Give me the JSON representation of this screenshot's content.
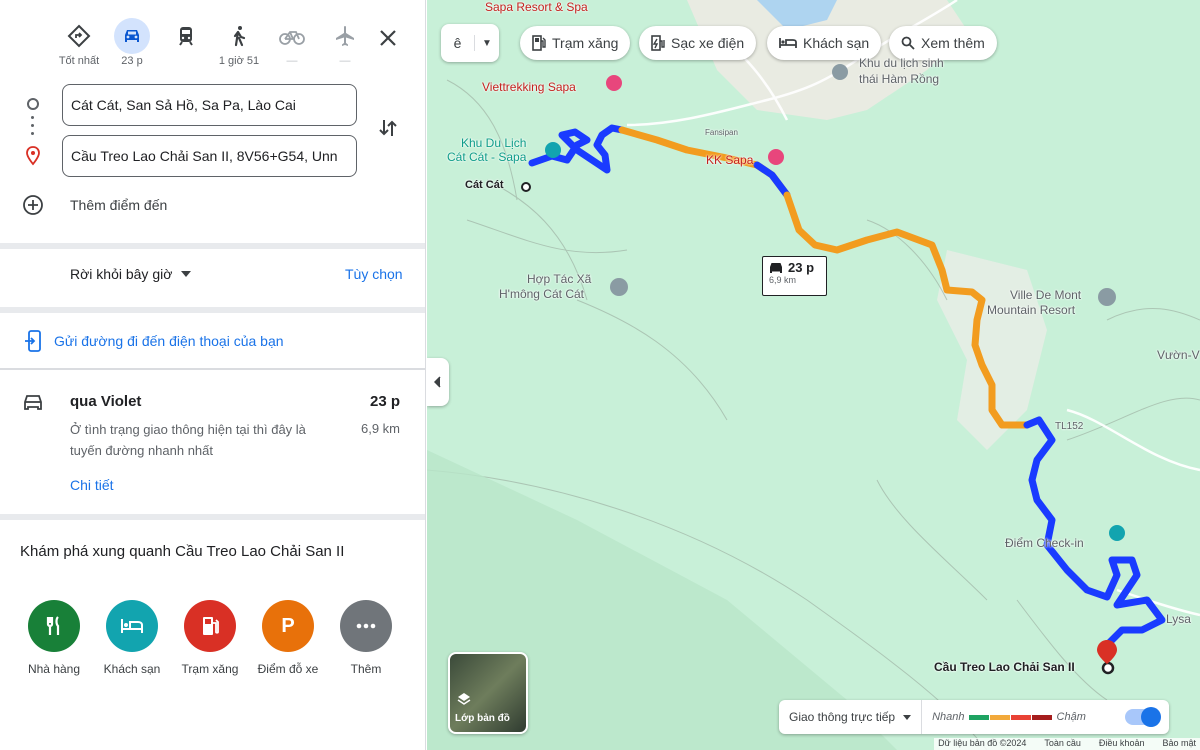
{
  "travel_modes": [
    {
      "name": "best",
      "label": "Tốt nhất"
    },
    {
      "name": "driving",
      "label": "23 p"
    },
    {
      "name": "transit",
      "label": ""
    },
    {
      "name": "walking",
      "label": "1 giờ 51"
    },
    {
      "name": "cycling",
      "label": "—"
    },
    {
      "name": "flight",
      "label": "—"
    }
  ],
  "directions": {
    "origin": "Cát Cát, San Sả Hồ, Sa Pa, Lào Cai",
    "destination": "Cầu Treo Lao Chải San II, 8V56+G54, Unn",
    "add_destination": "Thêm điểm đến"
  },
  "departure": {
    "label": "Rời khỏi bây giờ",
    "options": "Tùy chọn"
  },
  "send_to_phone": "Gửi đường đi đến điện thoại của bạn",
  "route": {
    "via": "qua Violet",
    "time": "23 p",
    "distance": "6,9 km",
    "description": "Ở tình trạng giao thông hiện tại thì đây là tuyến đường nhanh nhất",
    "details_link": "Chi tiết"
  },
  "explore": {
    "title": "Khám phá xung quanh Cầu Treo Lao Chải San II",
    "categories": [
      {
        "label": "Nhà hàng",
        "icon": "restaurant-icon",
        "color": "#188038"
      },
      {
        "label": "Khách sạn",
        "icon": "hotel-icon",
        "color": "#12a4af"
      },
      {
        "label": "Trạm xăng",
        "icon": "gas-station-icon",
        "color": "#d93025"
      },
      {
        "label": "Điểm đỗ xe",
        "icon": "parking-icon",
        "color": "#e8710a"
      },
      {
        "label": "Thêm",
        "icon": "more-icon",
        "color": "#70757a"
      }
    ]
  },
  "map": {
    "lang_selector": "ê",
    "chips": [
      "Trạm xăng",
      "Sạc xe điện",
      "Khách sạn",
      "Xem thêm"
    ],
    "labels": {
      "sapa_resort": "Sapa Resort & Spa",
      "viettrekking": "Viettrekking Sapa",
      "khu_du_lich": "Khu du lịch sinh",
      "thai_ham_rong": "thái Hàm Rồng",
      "ktourism_1": "Khu Du Lịch",
      "ktourism_2": "Cát Cát - Sapa",
      "kk_sapa": "KK Sapa",
      "cat_cat": "Cát Cát",
      "htx_1": "Hợp Tác Xã",
      "htx_2": "H'mông Cát Cát",
      "ville_1": "Ville De Mont",
      "ville_2": "Mountain Resort",
      "vuon": "Vườn-V",
      "tl152": "TL152",
      "checkin": "Điểm Check-in",
      "destination": "Cầu Treo Lao Chải San II",
      "lysa": "Lysa",
      "fansipan": "Fansipan"
    },
    "route_box": {
      "time": "23 p",
      "distance": "6,9 km"
    },
    "layers_label": "Lớp bản đồ",
    "traffic": {
      "select": "Giao thông trực tiếp",
      "fast": "Nhanh",
      "slow": "Chậm"
    },
    "attribution": [
      "Dữ liệu bản đồ ©2024",
      "Toàn cầu",
      "Điều khoản",
      "Bảo mật"
    ],
    "colors": {
      "route_blue": "#1a3bff",
      "route_orange": "#f29c1f",
      "map_bg": "#c8f0d8"
    }
  }
}
